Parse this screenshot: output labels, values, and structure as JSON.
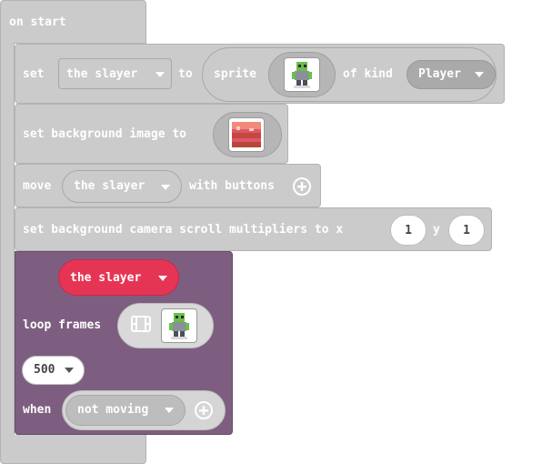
{
  "on_start": {
    "label": "on start"
  },
  "set_sprite": {
    "set_label": "set",
    "variable": "the slayer",
    "to_label": "to",
    "sprite_label": "sprite",
    "of_kind_label": "of kind",
    "kind": "Player"
  },
  "set_background": {
    "label": "set background image to"
  },
  "move": {
    "label": "move",
    "variable": "the slayer",
    "with_buttons_label": "with buttons"
  },
  "camera": {
    "label": "set background camera scroll multipliers to x",
    "x_value": "1",
    "y_label": "y",
    "y_value": "1"
  },
  "animation": {
    "sprite_variable": "the slayer",
    "loop_frames_label": "loop frames",
    "interval": "500",
    "when_label": "when",
    "condition": "not moving"
  },
  "colors": {
    "block_gray": "#cbcbcb",
    "animation_purple": "#7e5e80",
    "variable_red": "#e63554"
  }
}
